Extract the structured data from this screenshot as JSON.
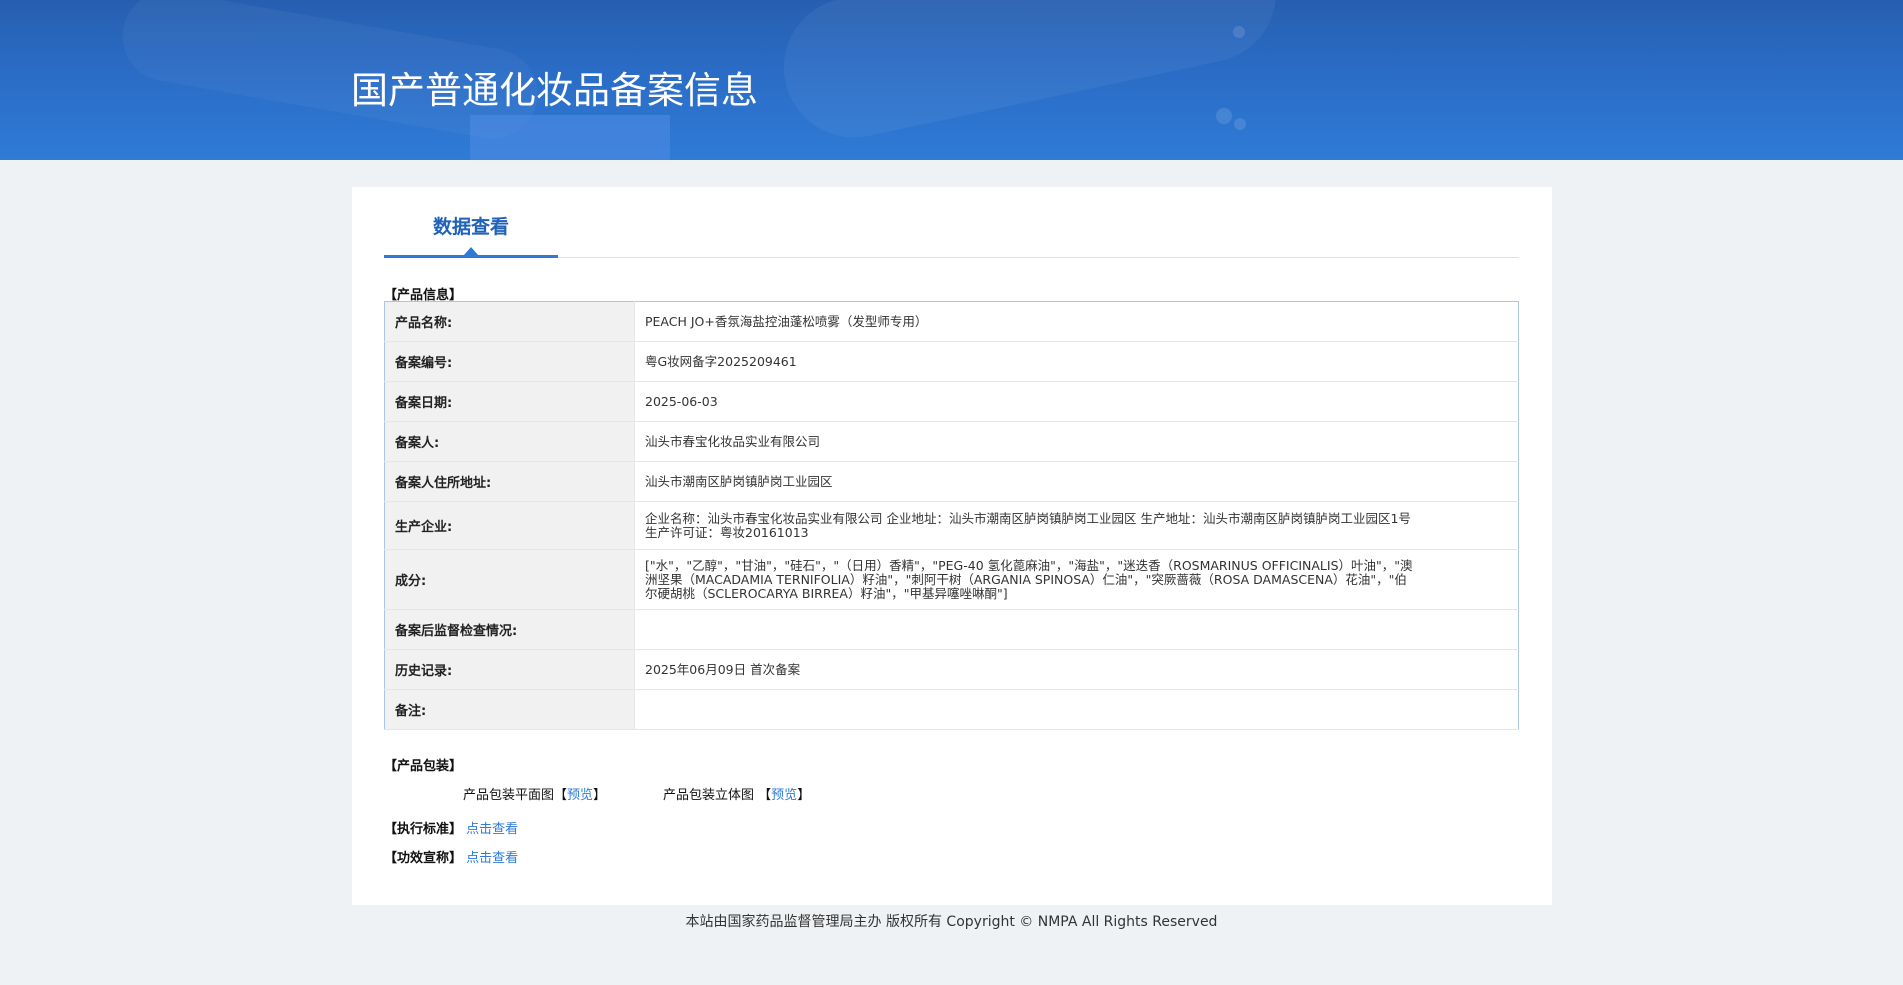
{
  "header": {
    "title": "国产普通化妆品备案信息"
  },
  "tabs": [
    {
      "label": "数据查看"
    }
  ],
  "product_info": {
    "section_title": "【产品信息】",
    "rows": [
      {
        "label": "产品名称:",
        "value": "PEACH JO+香氛海盐控油蓬松喷雾（发型师专用）"
      },
      {
        "label": "备案编号:",
        "value": "粤G妆网备字2025209461"
      },
      {
        "label": "备案日期:",
        "value": "2025-06-03"
      },
      {
        "label": "备案人:",
        "value": "汕头市春宝化妆品实业有限公司"
      },
      {
        "label": "备案人住所地址:",
        "value": "汕头市潮南区胪岗镇胪岗工业园区"
      },
      {
        "label": "生产企业:",
        "value": "企业名称：汕头市春宝化妆品实业有限公司 企业地址：汕头市潮南区胪岗镇胪岗工业园区 生产地址：汕头市潮南区胪岗镇胪岗工业园区1号\n生产许可证：粤妆20161013"
      },
      {
        "label": "成分:",
        "value": "[\"水\"，\"乙醇\"，\"甘油\"，\"硅石\"，\"（日用）香精\"，\"PEG-40 氢化蓖麻油\"，\"海盐\"，\"迷迭香（ROSMARINUS OFFICINALIS）叶油\"，\"澳\n洲坚果（MACADAMIA TERNIFOLIA）籽油\"，\"刺阿干树（ARGANIA SPINOSA）仁油\"，\"突厥蔷薇（ROSA DAMASCENA）花油\"，\"伯\n尔硬胡桃（SCLEROCARYA BIRREA）籽油\"，\"甲基异噻唑啉酮\"]"
      },
      {
        "label": "备案后监督检查情况:",
        "value": ""
      },
      {
        "label": "历史记录:",
        "value": "2025年06月09日 首次备案"
      },
      {
        "label": "备注:",
        "value": ""
      }
    ]
  },
  "packaging": {
    "section_title": "【产品包装】",
    "flat_label": "产品包装平面图",
    "solid_label": "产品包装立体图",
    "bracket_open": "【",
    "bracket_close": "】",
    "preview": "预览"
  },
  "standard": {
    "label": "【执行标准】",
    "link": "点击查看"
  },
  "efficacy": {
    "label": "【功效宣称】",
    "link": "点击查看"
  },
  "footer": {
    "text": "本站由国家药品监督管理局主办 版权所有 Copyright © NMPA All Rights Reserved"
  },
  "colors": {
    "accent": "#2d7bd6",
    "banner": "#2a6cc6",
    "background": "#eff2f5"
  }
}
